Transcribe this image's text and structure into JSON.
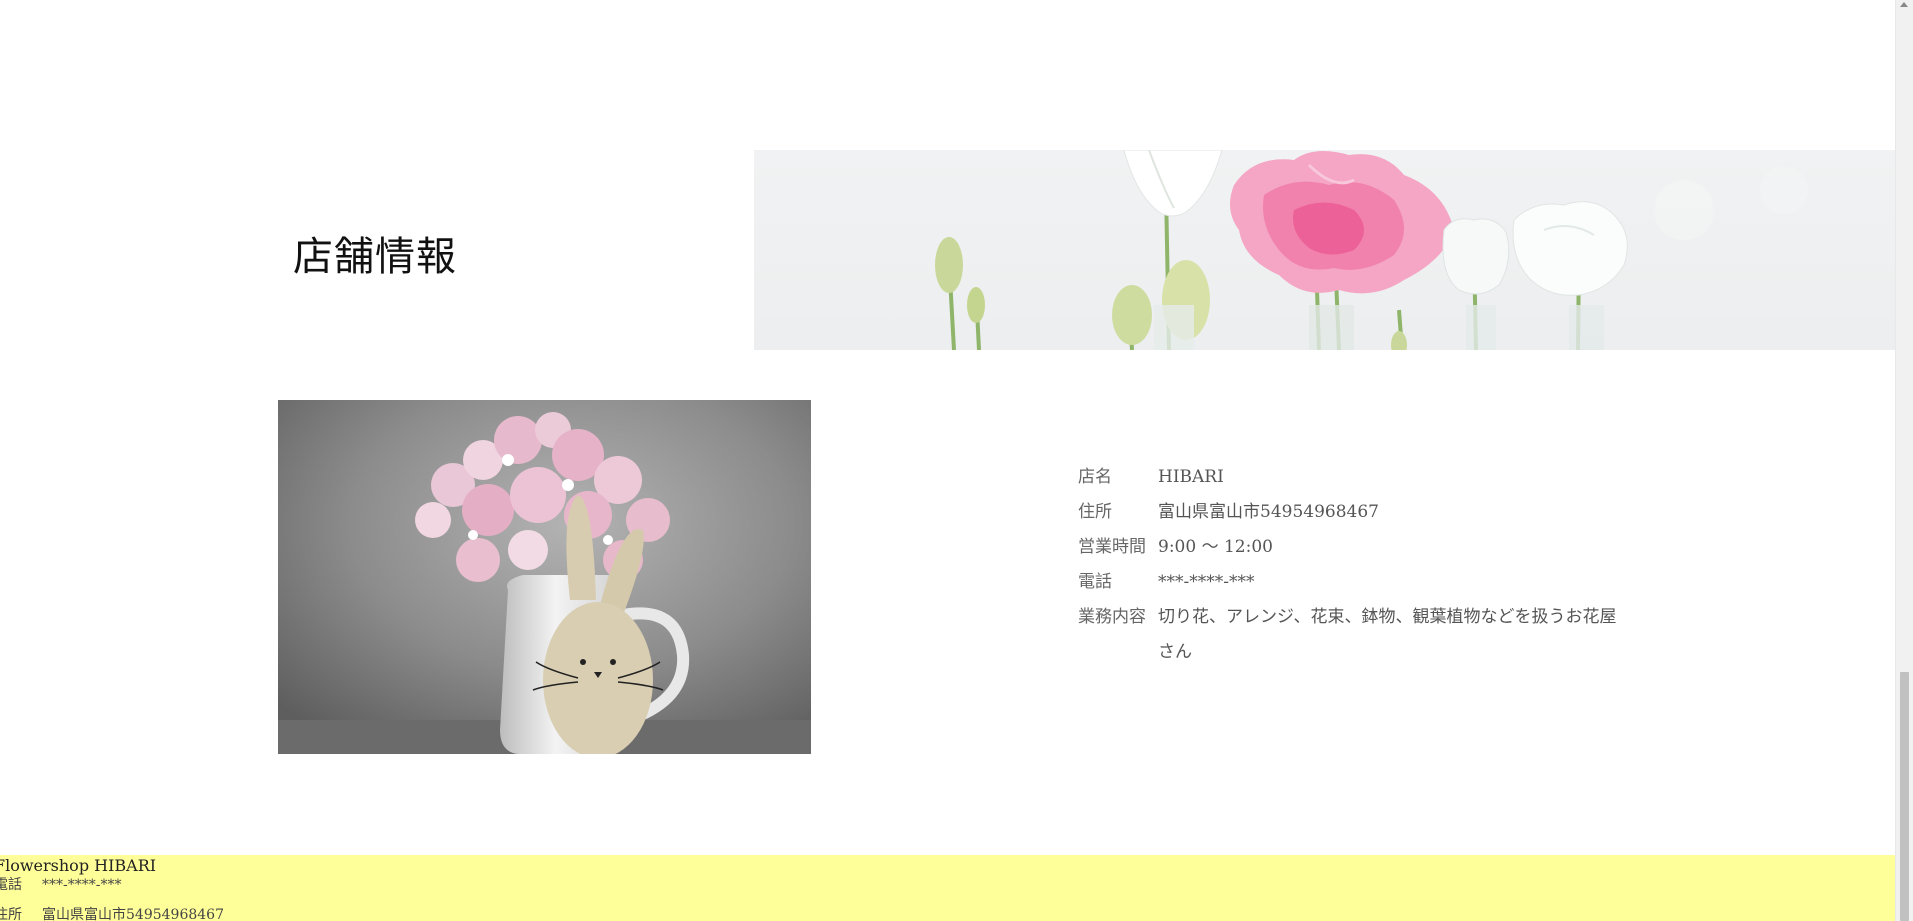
{
  "section": {
    "title": "店舗情報"
  },
  "shop_info": {
    "rows": [
      {
        "label": "店名",
        "value": "HIBARI"
      },
      {
        "label": "住所",
        "value": "富山県富山市54954968467"
      },
      {
        "label": "営業時間",
        "value": "9:00 ～ 12:00"
      },
      {
        "label": "電話",
        "value": "***-****-***"
      },
      {
        "label": "業務内容",
        "value": "切り花、アレンジ、花束、鉢物、観葉植物などを扱うお花屋さん"
      }
    ]
  },
  "footer": {
    "shop_name": "Flowershop HIBARI",
    "phone_label": "電話",
    "phone_value": "***-****-***",
    "address_label": "住所",
    "address_value": "富山県富山市54954968467"
  },
  "colors": {
    "footer_bg": "#ffff99",
    "banner_bg": "#eef0f1",
    "photo_bg": "#8e8e8e"
  },
  "images": {
    "banner": "flowers-banner-image",
    "shop_photo": "pink-blossoms-in-white-jug-with-wooden-bunny-image"
  }
}
